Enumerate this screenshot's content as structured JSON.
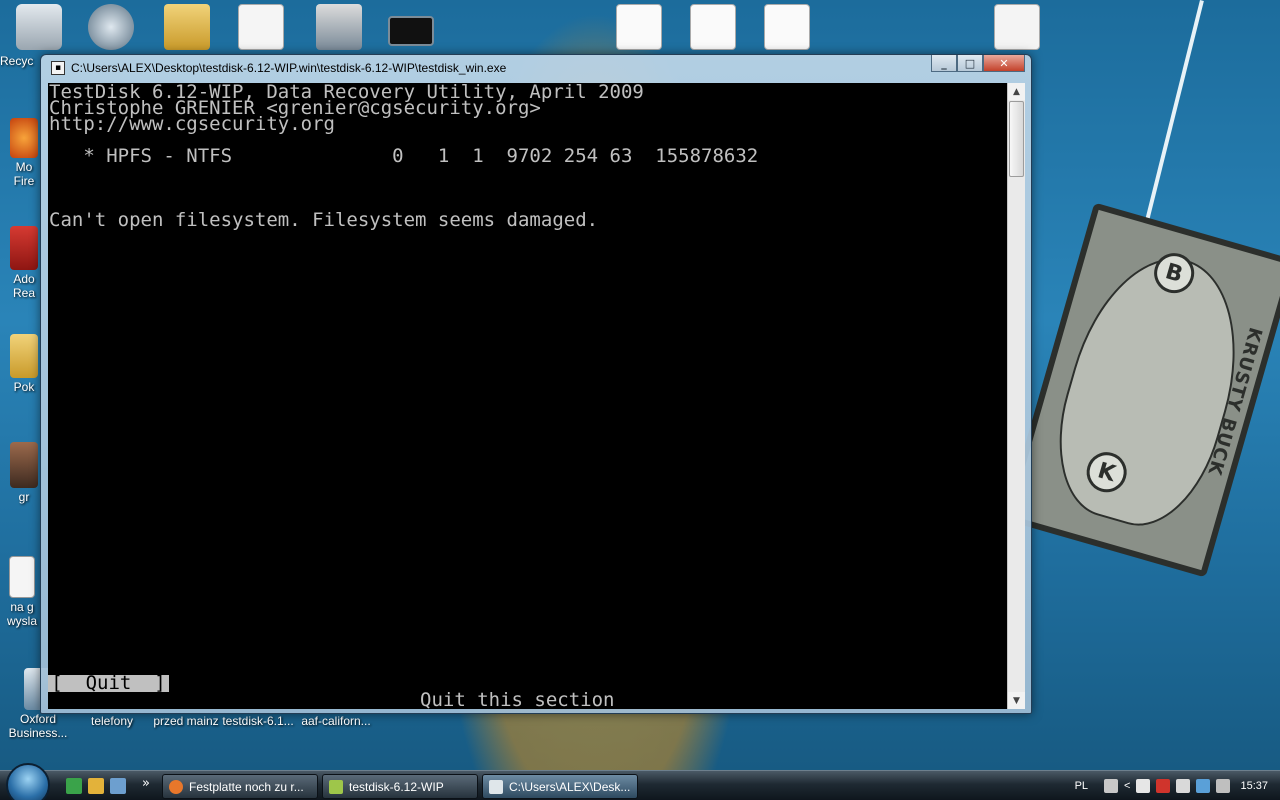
{
  "window": {
    "title": "C:\\Users\\ALEX\\Desktop\\testdisk-6.12-WIP.win\\testdisk-6.12-WIP\\testdisk_win.exe",
    "controls": {
      "minimize": "_",
      "maximize": "□",
      "close": "✕"
    }
  },
  "console": {
    "header_line1": "TestDisk 6.12-WIP, Data Recovery Utility, April 2009",
    "header_line2": "Christophe GRENIER <grenier@cgsecurity.org>",
    "header_line3": "http://www.cgsecurity.org",
    "partition_line": "   * HPFS - NTFS              0   1  1  9702 254 63  155878632",
    "message": "Can't open filesystem. Filesystem seems damaged.",
    "quit_button": "[  Quit  ]",
    "quit_hint": "Quit this section"
  },
  "desktop": {
    "icons": [
      {
        "label": "Recyc"
      },
      {
        "label": "Mo\nFire"
      },
      {
        "label": "Ado\nRea"
      },
      {
        "label": "Pok"
      },
      {
        "label": "gr"
      },
      {
        "label": "na g\nwysla"
      },
      {
        "label": "Oxford\nBusiness..."
      },
      {
        "label": "telefony"
      },
      {
        "label": "przed mainz"
      },
      {
        "label": "testdisk-6.1..."
      },
      {
        "label": "aaf-californ..."
      }
    ],
    "bill_text": "KRUSTY BUCK",
    "bill_letters": [
      "B",
      "K"
    ]
  },
  "taskbar": {
    "tasks": [
      {
        "label": "Festplatte noch zu r...",
        "color": "#e8772b"
      },
      {
        "label": "testdisk-6.12-WIP",
        "color": "#9ec64a"
      },
      {
        "label": "C:\\Users\\ALEX\\Desk...",
        "color": "#dfe6ea"
      }
    ],
    "language": "PL",
    "time": "15:37",
    "chevron": "»",
    "tray_arrow": "<"
  },
  "colors": {
    "console_bg": "#000000",
    "console_fg": "#c0c0c0",
    "highlight_bg": "#c0c0c0"
  }
}
